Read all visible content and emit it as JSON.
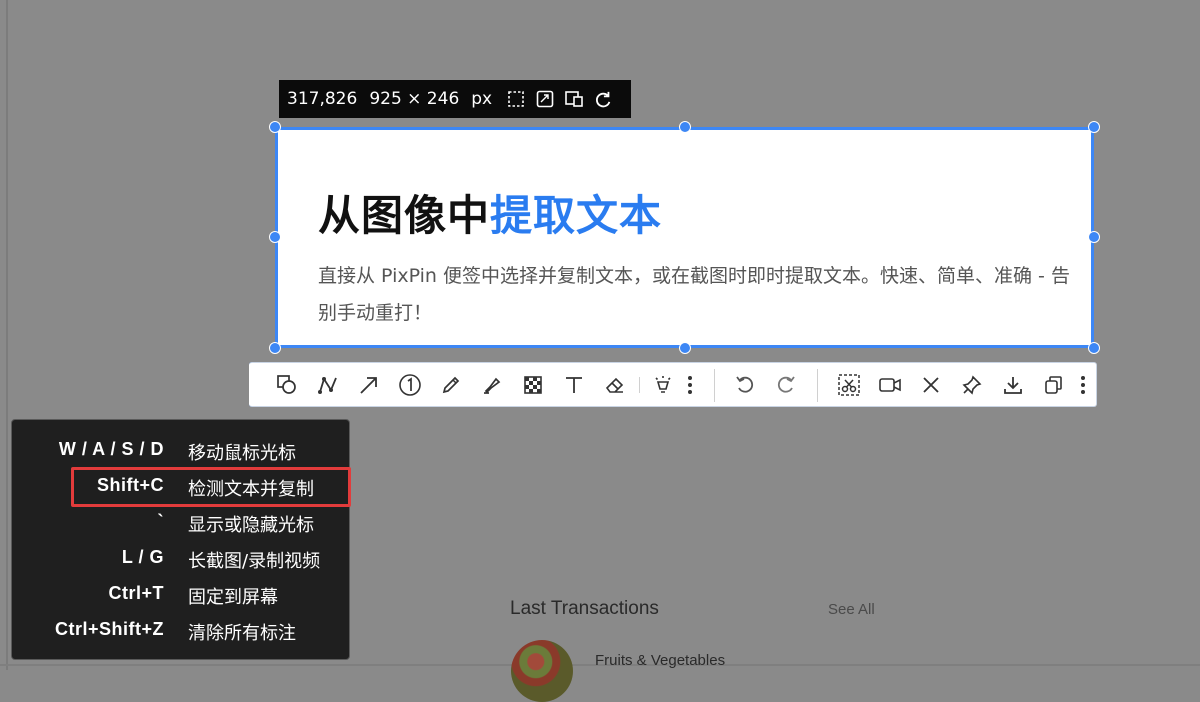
{
  "info_bar": {
    "coords": "317,826",
    "size": "925 × 246",
    "unit": "px",
    "icons": [
      "dashed-rect-icon",
      "resize-rect-icon",
      "screen-window-icon",
      "refresh-icon"
    ]
  },
  "selection": {
    "title_plain": "从图像中",
    "title_accent": "提取文本",
    "description": "直接从 PixPin 便签中选择并复制文本，或在截图时即时提取文本。快速、简单、准确 - 告别手动重打！"
  },
  "toolbar": {
    "tools": [
      "shapes-icon",
      "polyline-icon",
      "arrow-icon",
      "number-marker-icon",
      "pencil-icon",
      "highlighter-icon",
      "mosaic-icon",
      "text-icon",
      "eraser-icon",
      "lightbulb-icon",
      "undo-icon",
      "redo-icon",
      "capture-scissors-icon",
      "record-video-icon",
      "close-icon",
      "pin-icon",
      "download-icon",
      "copy-icon"
    ]
  },
  "shortcuts": [
    {
      "key": "W / A / S / D",
      "desc": "移动鼠标光标"
    },
    {
      "key": "Shift+C",
      "desc": "检测文本并复制"
    },
    {
      "key": "`",
      "desc": "显示或隐藏光标"
    },
    {
      "key": "L / G",
      "desc": "长截图/录制视频"
    },
    {
      "key": "Ctrl+T",
      "desc": "固定到屏幕"
    },
    {
      "key": "Ctrl+Shift+Z",
      "desc": "清除所有标注"
    }
  ],
  "background": {
    "heading": "Last Transactions",
    "link": "See All",
    "item": "Fruits & Vegetables"
  },
  "colors": {
    "accent": "#3d87f5",
    "title_accent": "#2a7cf0",
    "highlight": "#e23b3b",
    "overlay": "#8a8a8a"
  }
}
